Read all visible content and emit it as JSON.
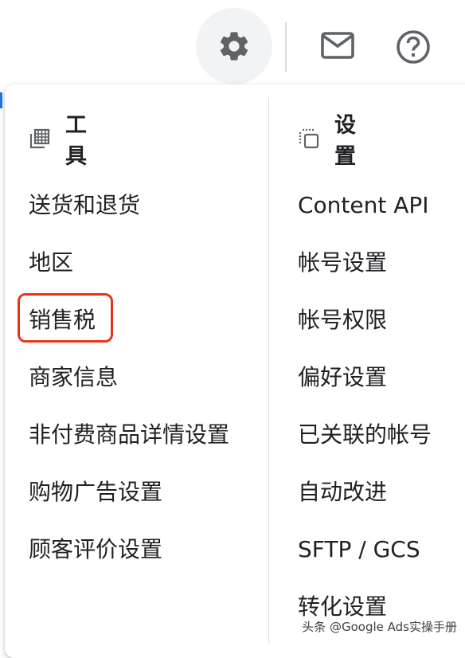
{
  "topbar": {
    "settings_icon": "gear-icon",
    "mail_icon": "mail-icon",
    "help_icon": "help-icon"
  },
  "menu": {
    "tools": {
      "header_icon": "tools-grid-icon",
      "header_label": "工具",
      "items": [
        "送货和退货",
        "地区",
        "销售税",
        "商家信息",
        "非付费商品详情设置",
        "购物广告设置",
        "顾客评价设置"
      ],
      "highlighted_item": "销售税"
    },
    "settings": {
      "header_icon": "copy-settings-icon",
      "header_label": "设置",
      "items": [
        "Content API",
        "帐号设置",
        "帐号权限",
        "偏好设置",
        "已关联的帐号",
        "自动改进",
        "SFTP / GCS",
        "转化设置"
      ]
    }
  },
  "watermark": "头条 @Google Ads实操手册",
  "colors": {
    "highlight": "#e8341c",
    "accent": "#1a73e8",
    "icon": "#5f6368",
    "text": "#202124"
  }
}
